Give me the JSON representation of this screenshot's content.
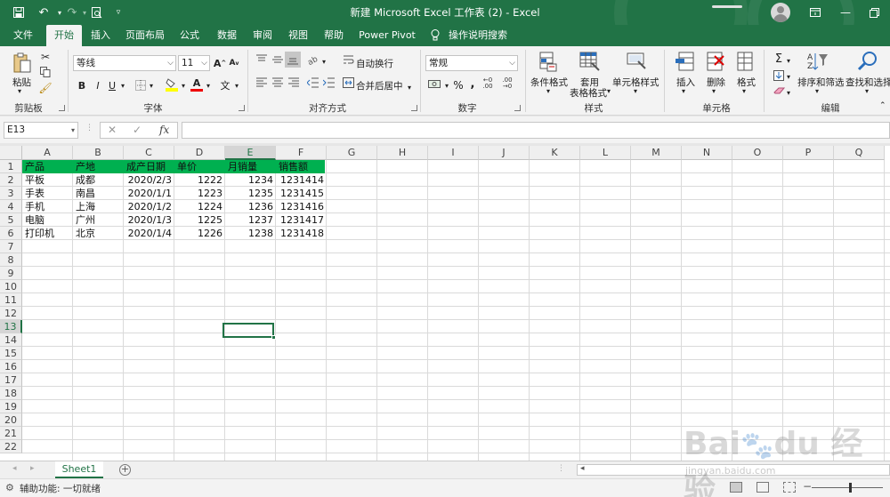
{
  "window": {
    "title": "新建 Microsoft Excel 工作表 (2)  -  Excel"
  },
  "ribbon_tabs": [
    {
      "label": "文件"
    },
    {
      "label": "开始",
      "active": true
    },
    {
      "label": "插入"
    },
    {
      "label": "页面布局"
    },
    {
      "label": "公式"
    },
    {
      "label": "数据"
    },
    {
      "label": "审阅"
    },
    {
      "label": "视图"
    },
    {
      "label": "帮助"
    },
    {
      "label": "Power Pivot"
    },
    {
      "label": "操作说明搜索"
    }
  ],
  "ribbon": {
    "clipboard": {
      "paste": "粘贴",
      "group": "剪贴板"
    },
    "font": {
      "name": "等线",
      "size": "11",
      "group": "字体",
      "bold": "B",
      "italic": "I",
      "underline": "U",
      "grow": "A",
      "shrink": "A",
      "wen": "文",
      "color_a": "A"
    },
    "align": {
      "wrap": "自动换行",
      "merge": "合并后居中",
      "group": "对齐方式"
    },
    "number": {
      "format": "常规",
      "percent": "%",
      "comma": ",",
      "group": "数字"
    },
    "styles": {
      "cond": "条件格式",
      "table1": "套用",
      "table2": "表格格式",
      "cell": "单元格样式",
      "group": "样式"
    },
    "cells": {
      "insert": "插入",
      "delete": "删除",
      "format": "格式",
      "group": "单元格"
    },
    "editing": {
      "sort": "排序和筛选",
      "find": "查找和选择",
      "group": "编辑",
      "sigma": "Σ"
    }
  },
  "formula_bar": {
    "name_box": "E13",
    "fx": "fx",
    "cancel": "✕",
    "enter": "✓",
    "value": ""
  },
  "columns": [
    "A",
    "B",
    "C",
    "D",
    "E",
    "F",
    "G",
    "H",
    "I",
    "J",
    "K",
    "L",
    "M",
    "N",
    "O",
    "P",
    "Q"
  ],
  "rows": [
    "1",
    "2",
    "3",
    "4",
    "5",
    "6",
    "7",
    "8",
    "9",
    "10",
    "11",
    "12",
    "13",
    "14",
    "15",
    "16",
    "17",
    "18",
    "19",
    "20",
    "21",
    "22"
  ],
  "table": {
    "headers": [
      "产品",
      "产地",
      "成产日期",
      "单价",
      "月销量",
      "销售额"
    ],
    "rows": [
      [
        "平板",
        "成都",
        "2020/2/3",
        "1222",
        "1234",
        "1231414"
      ],
      [
        "手表",
        "南昌",
        "2020/1/1",
        "1223",
        "1235",
        "1231415"
      ],
      [
        "手机",
        "上海",
        "2020/1/2",
        "1224",
        "1236",
        "1231416"
      ],
      [
        "电脑",
        "广州",
        "2020/1/3",
        "1225",
        "1237",
        "1231417"
      ],
      [
        "打印机",
        "北京",
        "2020/1/4",
        "1226",
        "1238",
        "1231418"
      ]
    ]
  },
  "sheets": [
    {
      "label": "Sheet1"
    }
  ],
  "status": {
    "accessibility": "辅助功能: 一切就绪"
  },
  "watermark": {
    "brand": "Bai du 经验",
    "url": "jingyan.baidu.com"
  },
  "colors": {
    "excel_green": "#217346",
    "header_fill": "#00b050"
  }
}
